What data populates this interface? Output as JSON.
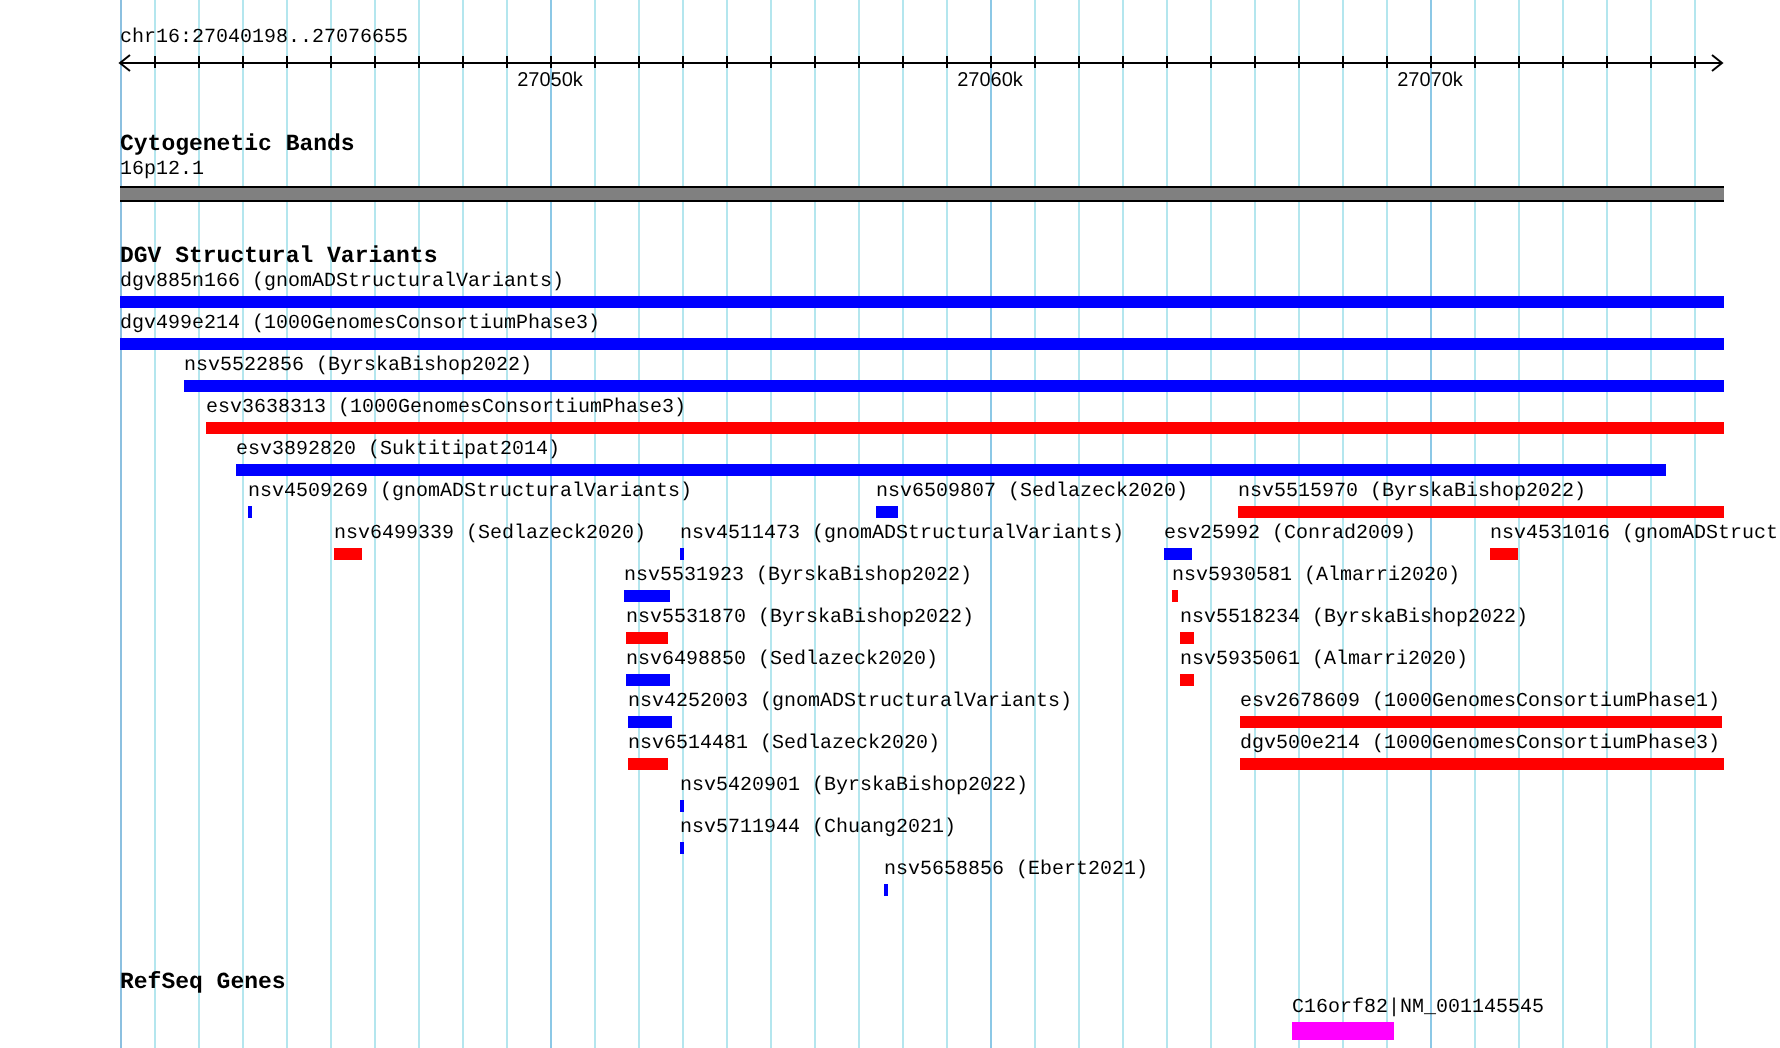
{
  "ruler": {
    "location": "chr16:27040198..27076655",
    "ticks": [
      "27050k",
      "27060k",
      "27070k"
    ]
  },
  "tracks": [
    {
      "kind": "bands",
      "title": "Cytogenetic Bands",
      "band_label": "16p12.1"
    },
    {
      "kind": "features",
      "title": "DGV Structural Variants",
      "rows": [
        {
          "features": [
            {
              "label": "dgv885n166 (gnomADStructuralVariants)",
              "color": "#0000ff"
            }
          ]
        },
        {
          "features": [
            {
              "label": "dgv499e214 (1000GenomesConsortiumPhase3)",
              "color": "#0000ff"
            }
          ]
        },
        {
          "features": [
            {
              "label": "nsv5522856 (ByrskaBishop2022)",
              "color": "#0000ff"
            }
          ]
        },
        {
          "features": [
            {
              "label": "esv3638313 (1000GenomesConsortiumPhase3)",
              "color": "#ff0000"
            }
          ]
        },
        {
          "features": [
            {
              "label": "esv3892820 (Suktitipat2014)",
              "color": "#0000ff"
            }
          ]
        },
        {
          "features": [
            {
              "label": "nsv4509269 (gnomADStructuralVariants)",
              "color": "#0000ff"
            },
            {
              "label": "nsv6509807 (Sedlazeck2020)",
              "color": "#0000ff"
            },
            {
              "label": "nsv5515970 (ByrskaBishop2022)",
              "color": "#ff0000"
            }
          ]
        },
        {
          "features": [
            {
              "label": "nsv6499339 (Sedlazeck2020)",
              "color": "#ff0000"
            },
            {
              "label": "nsv4511473 (gnomADStructuralVariants)",
              "color": "#0000ff"
            },
            {
              "label": "esv25992 (Conrad2009)",
              "color": "#0000ff"
            },
            {
              "label": "nsv4531016 (gnomADStruct",
              "color": "#ff0000"
            }
          ]
        },
        {
          "features": [
            {
              "label": "nsv5531923 (ByrskaBishop2022)",
              "color": "#0000ff"
            },
            {
              "label": "nsv5930581 (Almarri2020)",
              "color": "#ff0000"
            }
          ]
        },
        {
          "features": [
            {
              "label": "nsv5531870 (ByrskaBishop2022)",
              "color": "#ff0000"
            },
            {
              "label": "nsv5518234 (ByrskaBishop2022)",
              "color": "#ff0000"
            }
          ]
        },
        {
          "features": [
            {
              "label": "nsv6498850 (Sedlazeck2020)",
              "color": "#0000ff"
            },
            {
              "label": "nsv5935061 (Almarri2020)",
              "color": "#ff0000"
            }
          ]
        },
        {
          "features": [
            {
              "label": "nsv4252003 (gnomADStructuralVariants)",
              "color": "#0000ff"
            },
            {
              "label": "esv2678609 (1000GenomesConsortiumPhase1)",
              "color": "#ff0000"
            }
          ]
        },
        {
          "features": [
            {
              "label": "nsv6514481 (Sedlazeck2020)",
              "color": "#ff0000"
            },
            {
              "label": "dgv500e214 (1000GenomesConsortiumPhase3)",
              "color": "#ff0000"
            }
          ]
        },
        {
          "features": [
            {
              "label": "nsv5420901 (ByrskaBishop2022)",
              "color": "#0000ff"
            }
          ]
        },
        {
          "features": [
            {
              "label": "nsv5711944 (Chuang2021)",
              "color": "#0000ff"
            }
          ]
        },
        {
          "features": [
            {
              "label": "nsv5658856 (Ebert2021)",
              "color": "#0000ff"
            }
          ]
        }
      ]
    },
    {
      "kind": "features",
      "title": "RefSeq Genes",
      "rows": [
        {
          "features": [
            {
              "label": "C16orf82|NM_001145545",
              "color": "#ff00ff"
            }
          ]
        }
      ]
    }
  ]
}
